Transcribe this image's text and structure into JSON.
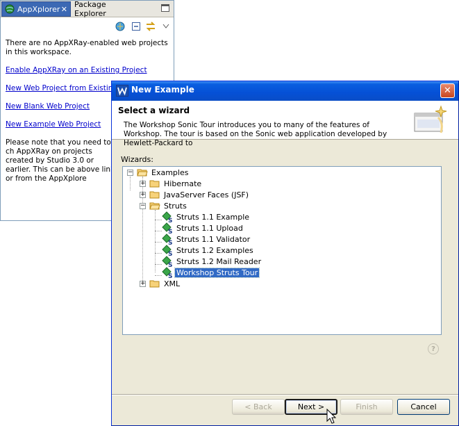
{
  "view": {
    "tabs": [
      {
        "label": "AppXplorer",
        "icon": "globe-icon",
        "active": true
      },
      {
        "label": "Package Explorer",
        "active": false
      }
    ],
    "close_symbol": "✕",
    "body": {
      "no_projects_text": "There are no AppXRay-enabled web projects in this workspace.",
      "links": [
        "Enable AppXRay on an Existing Project",
        "New Web Project from Existing S",
        "New Blank Web Project",
        "New Example Web Project"
      ],
      "note_text": "Please note that you need to ch AppXRay on projects created by Studio 3.0 or earlier. This can be above link or from the AppXplore"
    }
  },
  "dialog": {
    "title": "New Example",
    "close_symbol": "✕",
    "header": {
      "title": "Select a wizard",
      "description": "The Workshop Sonic Tour introduces you to many of the features of Workshop. The tour is based on the Sonic web application developed by Hewlett-Packard to"
    },
    "wizards_label": "Wizards:",
    "tree": {
      "root": "Examples",
      "folders": [
        "Hibernate",
        "JavaServer Faces (JSF)",
        "Struts",
        "XML"
      ],
      "struts_items": [
        "Struts 1.1 Example",
        "Struts 1.1 Upload",
        "Struts 1.1 Validator",
        "Struts 1.2 Examples",
        "Struts 1.2 Mail Reader",
        "Workshop Struts Tour"
      ],
      "selected": "Workshop Struts Tour"
    },
    "help_symbol": "?",
    "buttons": {
      "back": "< Back",
      "next": "Next >",
      "finish": "Finish",
      "cancel": "Cancel"
    }
  },
  "colors": {
    "selection": "#316ac5",
    "titlebar": "#0550d6",
    "link": "#0000cc",
    "dialog_bg": "#ece9d8"
  }
}
